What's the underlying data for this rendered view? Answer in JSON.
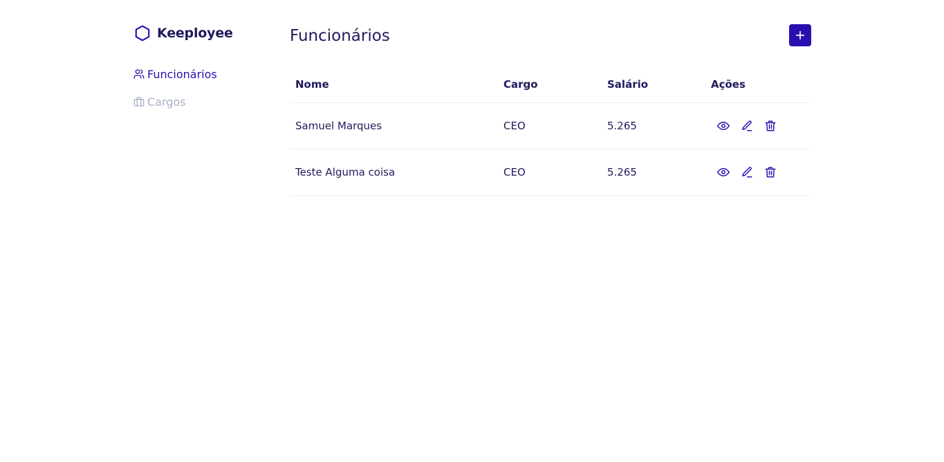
{
  "brand": {
    "name": "Keeployee",
    "icon": "hexagon-icon"
  },
  "sidebar": {
    "items": [
      {
        "label": "Funcionários",
        "icon": "users-icon",
        "active": true
      },
      {
        "label": "Cargos",
        "icon": "briefcase-icon",
        "active": false
      }
    ]
  },
  "main": {
    "title": "Funcionários",
    "add_button_icon": "plus-icon",
    "table": {
      "headers": [
        "Nome",
        "Cargo",
        "Salário",
        "Ações"
      ],
      "rows": [
        {
          "nome": "Samuel Marques",
          "cargo": "CEO",
          "salario": "5.265"
        },
        {
          "nome": "Teste Alguma coisa",
          "cargo": "CEO",
          "salario": "5.265"
        }
      ],
      "action_icons": [
        "eye-icon",
        "pencil-icon",
        "trash-icon"
      ]
    }
  },
  "colors": {
    "accent": "#2a0fb0",
    "text": "#1f1b5c",
    "muted": "#a7b0c8",
    "divider": "#eeeeef"
  }
}
